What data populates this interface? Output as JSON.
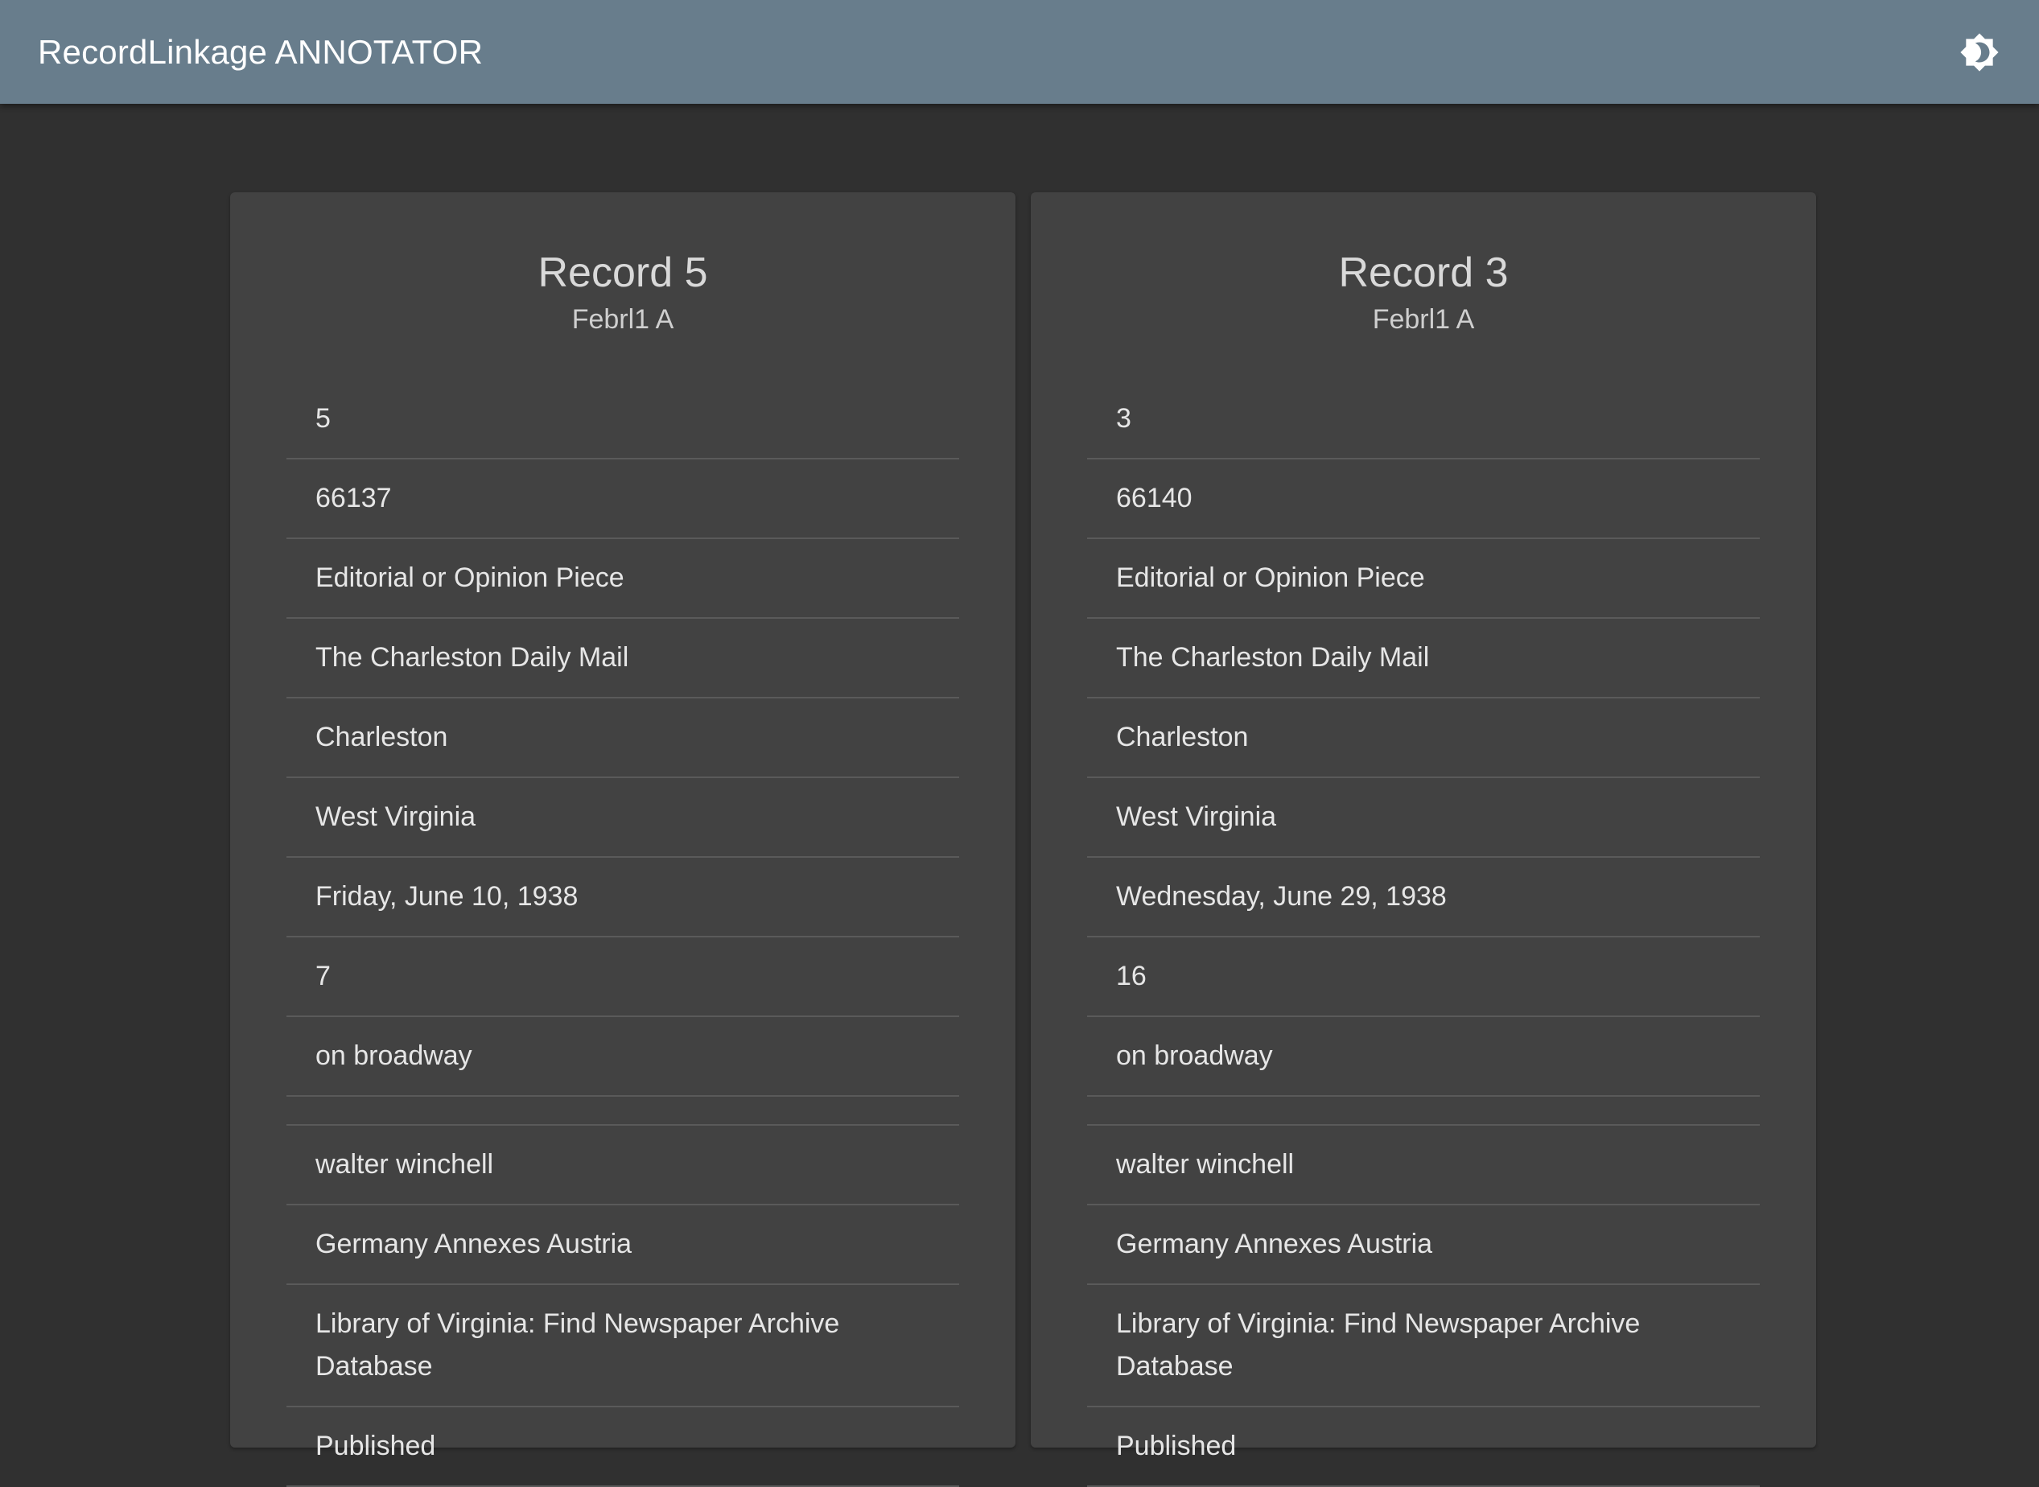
{
  "app": {
    "title": "RecordLinkage ANNOTATOR",
    "theme_icon": "brightness-icon"
  },
  "colors": {
    "app_bar": "#687d8c",
    "background": "#303030",
    "card": "#424242",
    "divider": "#5a5a5a"
  },
  "records": [
    {
      "title": "Record 5",
      "subtitle": "Febrl1 A",
      "fields": [
        "5",
        "66137",
        "Editorial or Opinion Piece",
        "The Charleston Daily Mail",
        "Charleston",
        "West Virginia",
        "Friday, June 10, 1938",
        "7",
        "on broadway",
        "",
        "walter winchell",
        "Germany Annexes Austria",
        "Library of Virginia: Find Newspaper Archive Database",
        "Published"
      ]
    },
    {
      "title": "Record 3",
      "subtitle": "Febrl1 A",
      "fields": [
        "3",
        "66140",
        "Editorial or Opinion Piece",
        "The Charleston Daily Mail",
        "Charleston",
        "West Virginia",
        "Wednesday, June 29, 1938",
        "16",
        "on broadway",
        "",
        "walter winchell",
        "Germany Annexes Austria",
        "Library of Virginia: Find Newspaper Archive Database",
        "Published"
      ]
    }
  ]
}
